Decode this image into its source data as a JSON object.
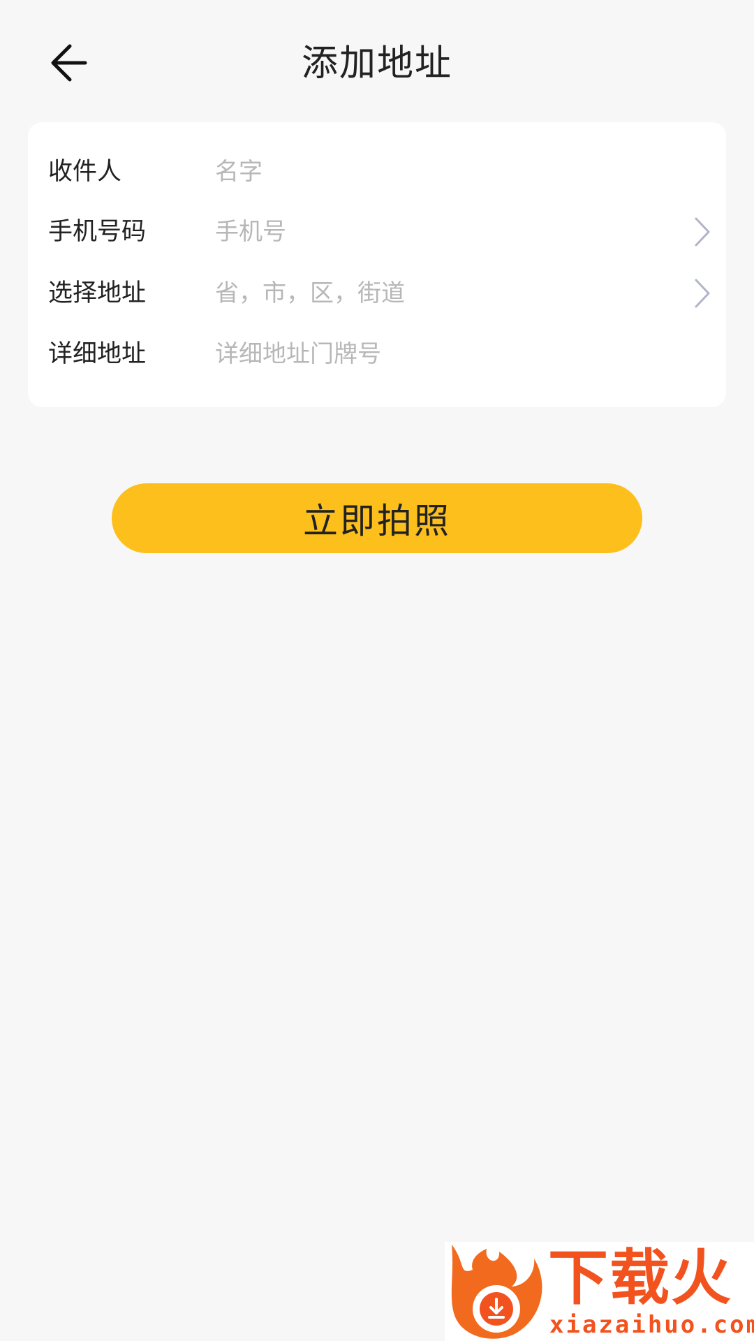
{
  "header": {
    "title": "添加地址",
    "back_icon": "arrow-left-icon"
  },
  "form": {
    "recipient": {
      "label": "收件人",
      "placeholder": "名字"
    },
    "phone": {
      "label": "手机号码",
      "placeholder": "手机号"
    },
    "region": {
      "label": "选择地址",
      "placeholder": "省，市，区，街道"
    },
    "detail": {
      "label": "详细地址",
      "placeholder": "详细地址门牌号"
    }
  },
  "actions": {
    "photo_label": "立即拍照"
  },
  "watermark": {
    "brand": "下载火",
    "url": "xiazaihuo.com"
  },
  "colors": {
    "accent": "#fdbf1c",
    "background": "#f7f7f7",
    "card": "#ffffff",
    "placeholder": "#b7b7b7",
    "chevron": "#b0b4c8",
    "watermark": "#f2521e"
  }
}
